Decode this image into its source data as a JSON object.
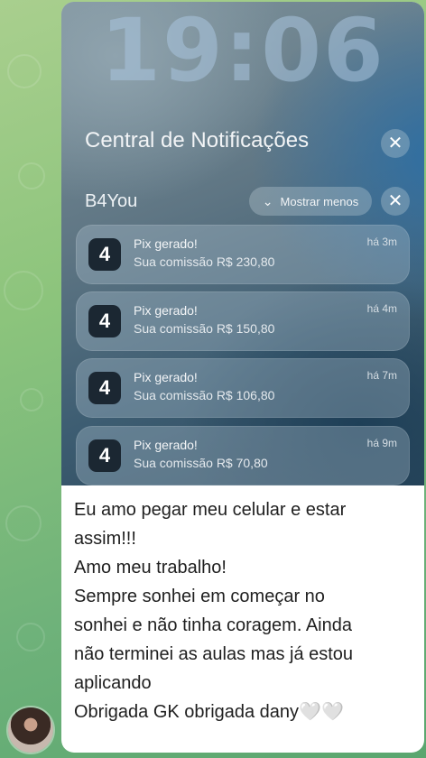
{
  "lockscreen": {
    "clock": "19:06",
    "center_title": "Central de Notificações",
    "group_name": "B4You",
    "show_less_label": "Mostrar menos",
    "notifications": [
      {
        "title": "Pix gerado!",
        "body": "Sua comissão R$ 230,80",
        "time": "há 3m"
      },
      {
        "title": "Pix gerado!",
        "body": "Sua comissão R$ 150,80",
        "time": "há 4m"
      },
      {
        "title": "Pix gerado!",
        "body": "Sua comissão R$ 106,80",
        "time": "há 7m"
      },
      {
        "title": "Pix gerado!",
        "body": "Sua comissão R$ 70,80",
        "time": "há 9m"
      }
    ]
  },
  "message": {
    "lines": [
      "Eu amo pegar meu celular e estar",
      "assim!!!",
      "Amo meu trabalho!",
      "Sempre sonhei em começar no",
      "sonhei e não tinha coragem. Ainda",
      "não terminei as aulas mas já estou",
      "aplicando",
      "Obrigada GK obrigada dany🤍🤍"
    ]
  },
  "icons": {
    "close": "close-icon",
    "chevron": "chevron-down-icon",
    "app": "b4you-app-icon",
    "avatar": "avatar"
  },
  "colors": {
    "chat_background": "#8cc47c",
    "bubble": "#ffffff",
    "app_icon_bg": "#1b2732"
  }
}
